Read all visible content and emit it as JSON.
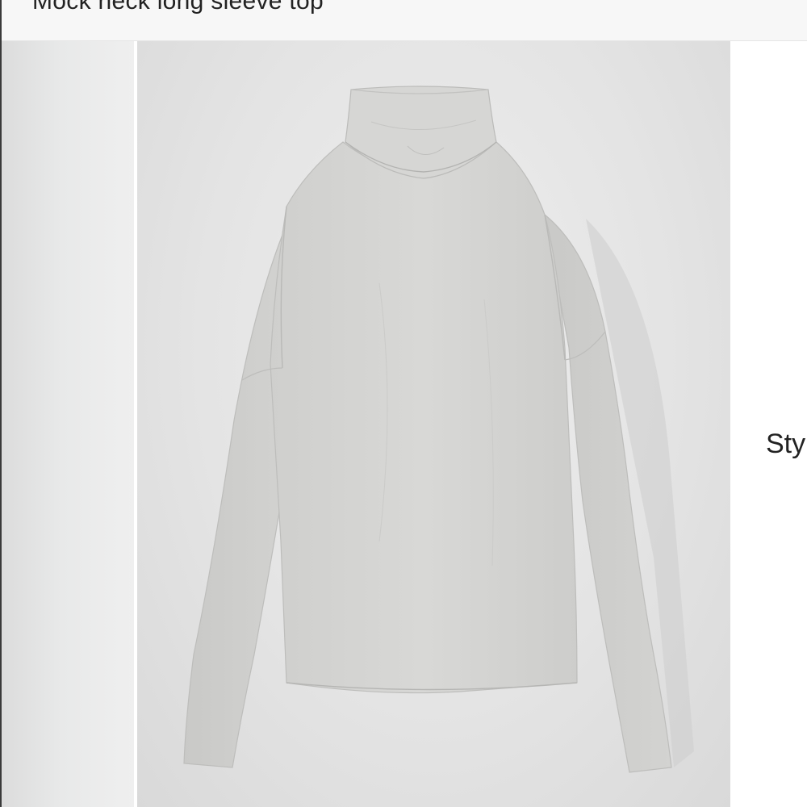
{
  "product": {
    "title": "Mock neck long sleeve top",
    "image_alt": "Mock neck long sleeve top in heather grey"
  },
  "side_panel": {
    "label": "Sty"
  },
  "colors": {
    "header_bg": "#f7f7f7",
    "photo_bg": "#e4e4e4",
    "garment": "#d4d4d2",
    "text": "#222222"
  }
}
